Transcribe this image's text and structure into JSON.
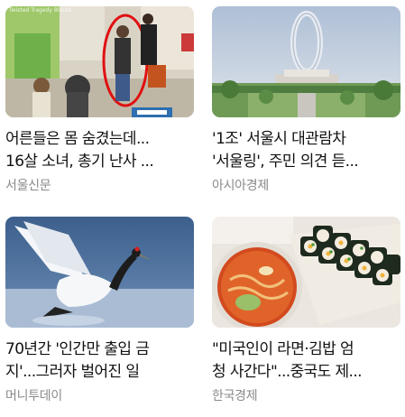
{
  "news": [
    {
      "title_line1": "어른들은 몸 숨겼는데...",
      "title_line2": "16살 소녀, 총기 난사 ...",
      "source": "서울신문",
      "watermark": "Twisted Tragedy Blocks"
    },
    {
      "title_line1": "'1조' 서울시 대관람차",
      "title_line2": "'서울링', 주민 의견 듣...",
      "source": "아시아경제"
    },
    {
      "title_line1": "70년간 '인간만 출입 금",
      "title_line2": "지'...그러자 벌어진 일",
      "source": "머니투데이"
    },
    {
      "title_line1": "\"미국인이 라면·김밥 엄",
      "title_line2": "청 사간다\"...중국도 제...",
      "source": "한국경제"
    }
  ]
}
